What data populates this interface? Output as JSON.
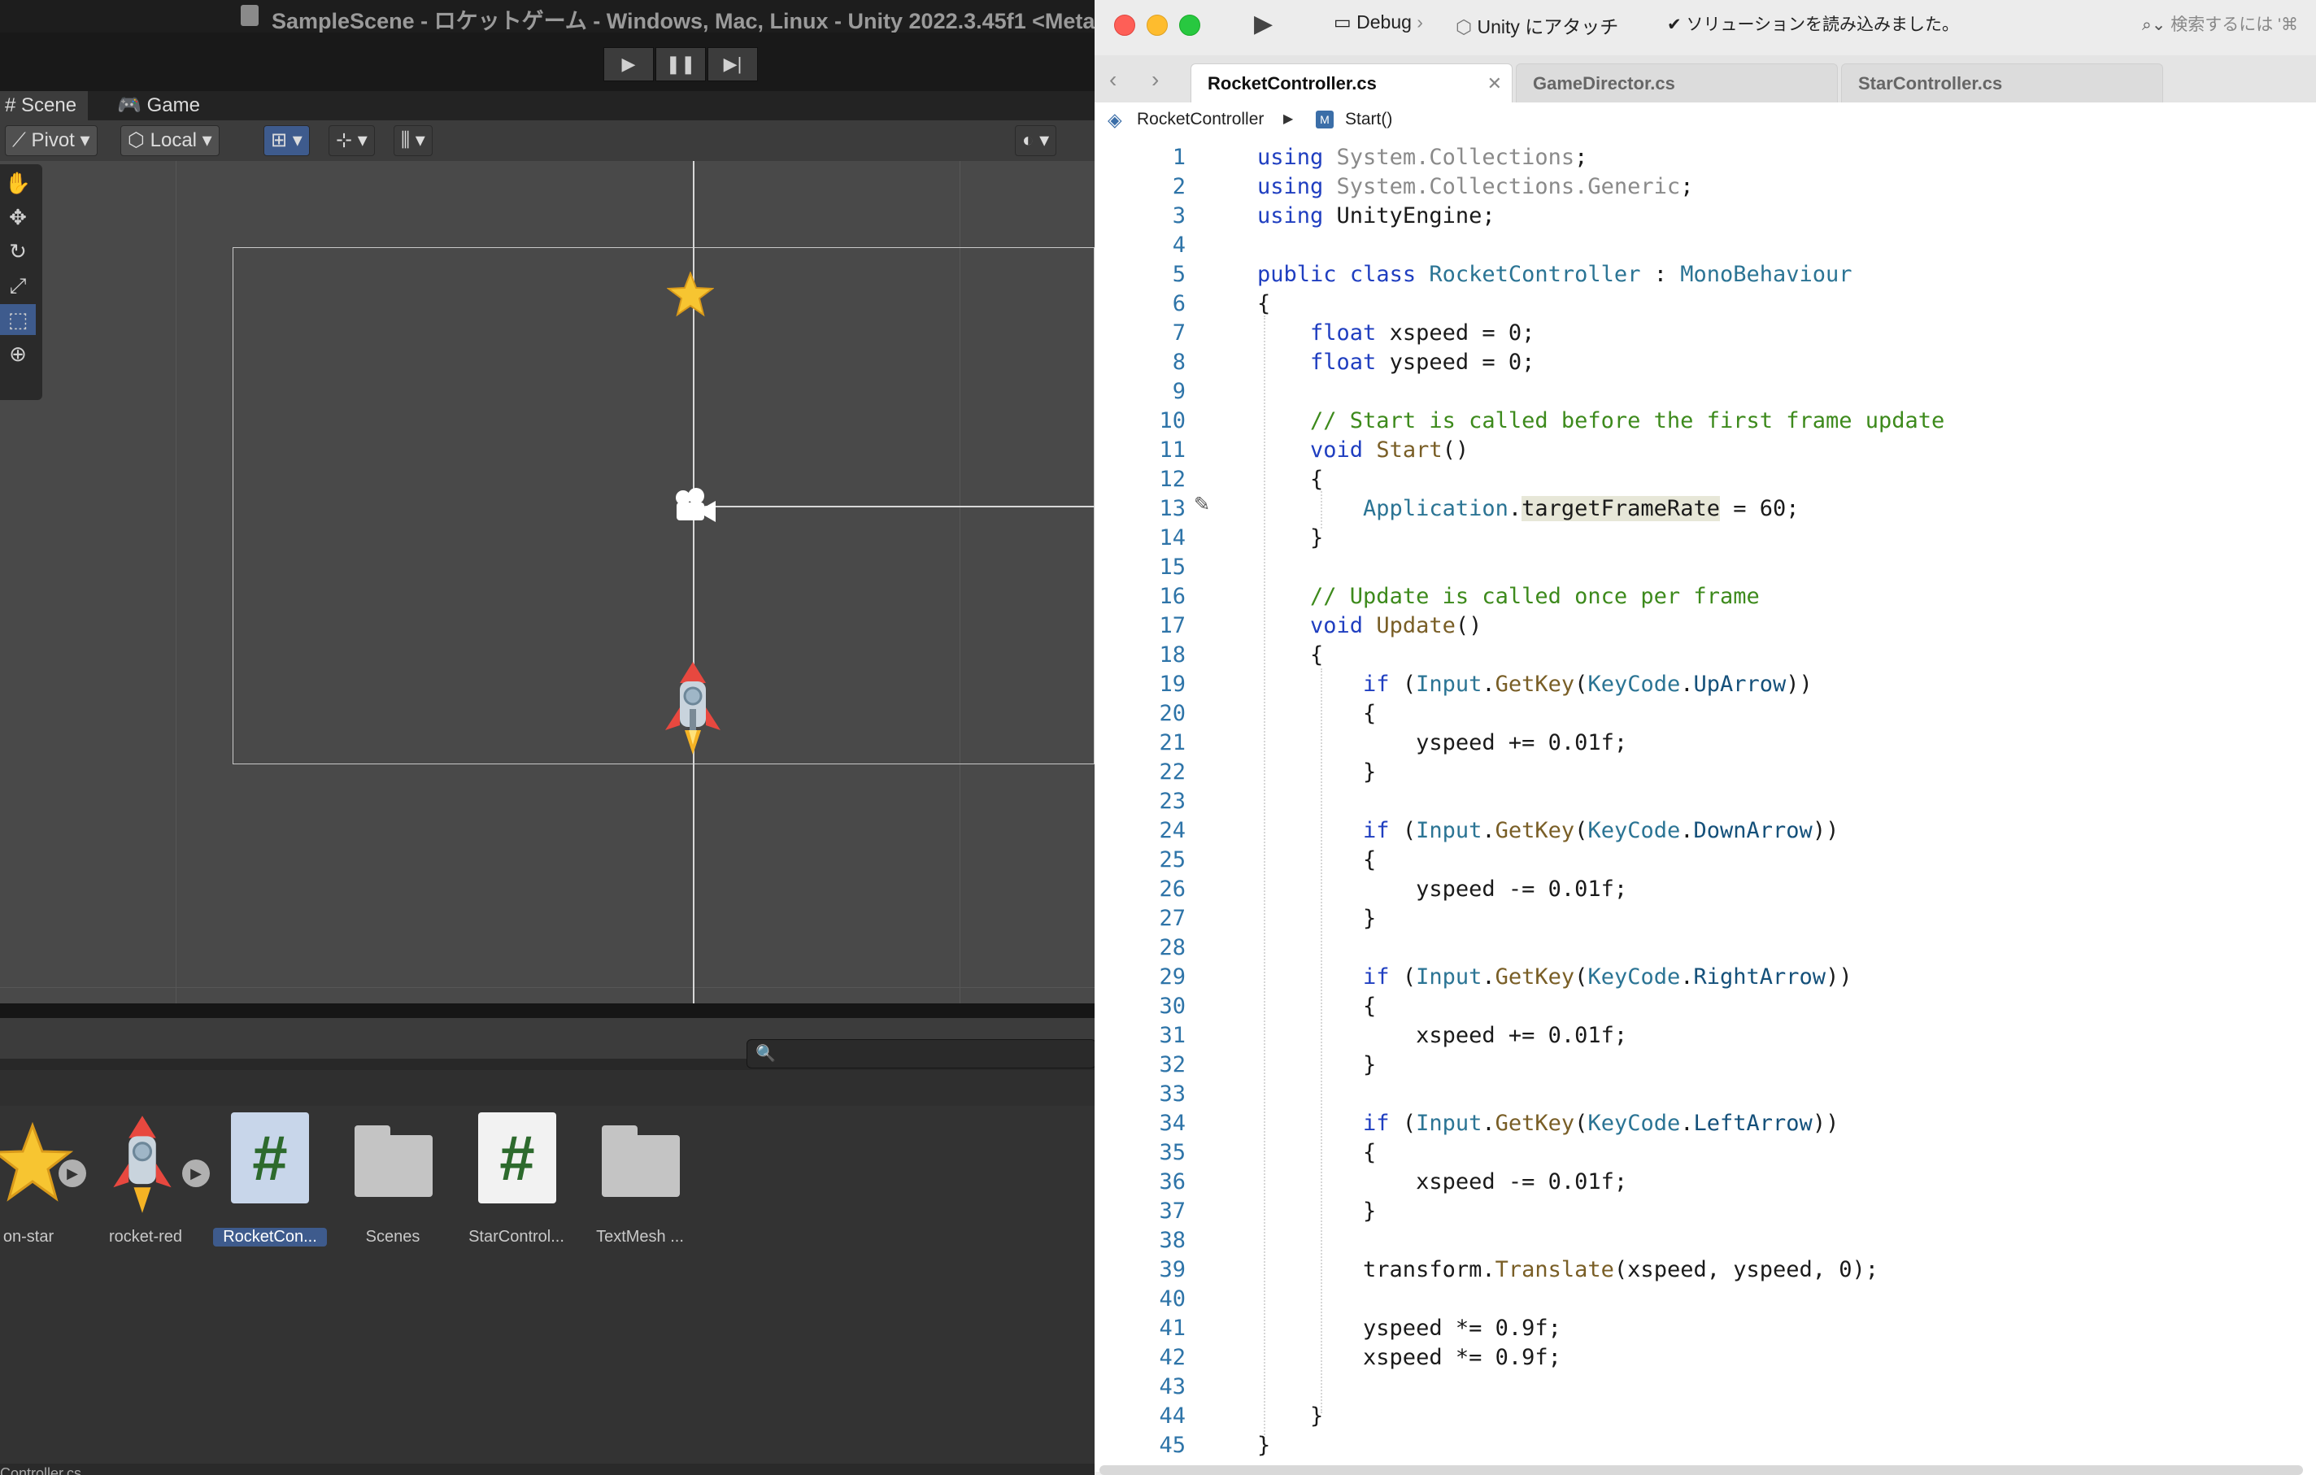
{
  "unity": {
    "window_title": "SampleScene - ロケットゲーム - Windows, Mac, Linux - Unity 2022.3.45f1 <Meta",
    "tabs": [
      {
        "label": "Scene"
      },
      {
        "label": "Game"
      }
    ],
    "toolbar": {
      "pivot_label": "Pivot",
      "local_label": "Local"
    },
    "assets": [
      {
        "label": "on-star"
      },
      {
        "label": "rocket-red"
      },
      {
        "label": "RocketCon..."
      },
      {
        "label": "Scenes"
      },
      {
        "label": "StarControl..."
      },
      {
        "label": "TextMesh ..."
      }
    ],
    "footer_text": "Controller.cs"
  },
  "vs": {
    "debug_label": "Debug",
    "attach_label": "Unity にアタッチ",
    "status_text": "ソリューションを読み込みました。",
    "search_placeholder": "検索するには '⌘",
    "tabs": [
      {
        "label": "RocketController.cs",
        "active": true
      },
      {
        "label": "GameDirector.cs"
      },
      {
        "label": "StarController.cs"
      }
    ],
    "breadcrumb": {
      "class_name": "RocketController",
      "method_name": "Start()"
    },
    "code_lines": [
      "using System.Collections;",
      "using System.Collections.Generic;",
      "using UnityEngine;",
      "",
      "public class RocketController : MonoBehaviour",
      "{",
      "    float xspeed = 0;",
      "    float yspeed = 0;",
      "",
      "    // Start is called before the first frame update",
      "    void Start()",
      "    {",
      "        Application.targetFrameRate = 60;",
      "    }",
      "",
      "    // Update is called once per frame",
      "    void Update()",
      "    {",
      "        if (Input.GetKey(KeyCode.UpArrow))",
      "        {",
      "            yspeed += 0.01f;",
      "        }",
      "",
      "        if (Input.GetKey(KeyCode.DownArrow))",
      "        {",
      "            yspeed -= 0.01f;",
      "        }",
      "",
      "        if (Input.GetKey(KeyCode.RightArrow))",
      "        {",
      "            xspeed += 0.01f;",
      "        }",
      "",
      "        if (Input.GetKey(KeyCode.LeftArrow))",
      "        {",
      "            xspeed -= 0.01f;",
      "        }",
      "",
      "        transform.Translate(xspeed, yspeed, 0);",
      "",
      "        yspeed *= 0.9f;",
      "        xspeed *= 0.9f;",
      "",
      "    }",
      "}"
    ]
  }
}
